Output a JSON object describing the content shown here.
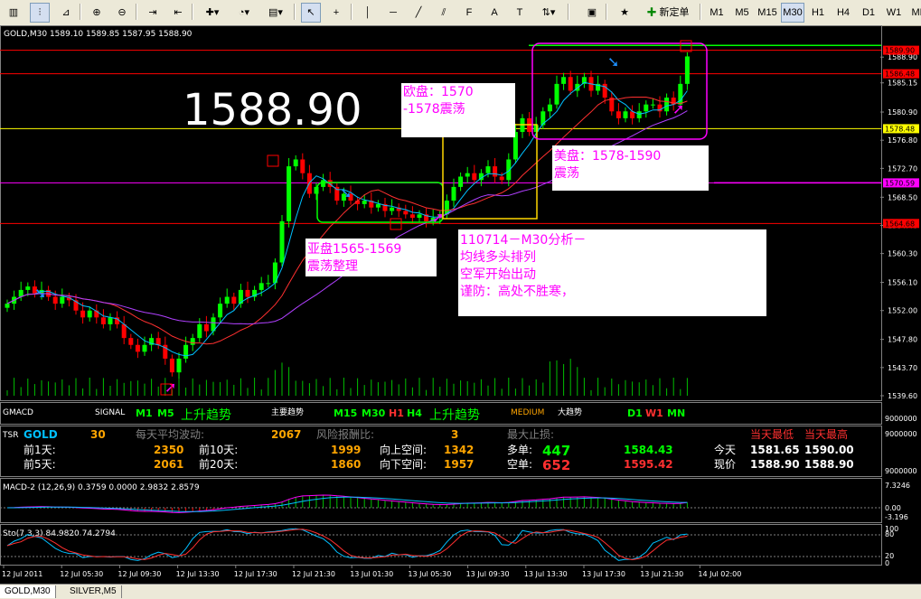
{
  "toolbar": {
    "new_order": "新定单",
    "periods": [
      "M1",
      "M5",
      "M15",
      "M30",
      "H1",
      "H4",
      "D1",
      "W1",
      "MN"
    ],
    "active_period": "M30"
  },
  "chart": {
    "header": "GOLD,M30  1589.10 1589.85 1587.95 1588.90",
    "big_price": "1588.90",
    "annotations": {
      "europe": [
        "欧盘：1570",
        "-1578震荡"
      ],
      "us": [
        "美盘：1578-1590",
        "震荡"
      ],
      "asia": [
        "亚盘1565-1569",
        "震荡整理"
      ],
      "analysis": [
        "110714－M30分析－",
        "均线多头排列",
        "空军开始出动",
        "谨防：高处不胜寒，"
      ]
    },
    "colors": {
      "bull": "#00ff00",
      "bear": "#ff0000",
      "ma_fast": "#00c0ff",
      "ma_mid": "#ff3030",
      "ma_slow": "#b040ff",
      "box_asia": "#00ff00",
      "box_eu": "#ffd700",
      "box_us": "#ff00ff"
    }
  },
  "chart_data": {
    "type": "candlestick",
    "symbol": "GOLD",
    "timeframe": "M30",
    "y_ticks": [
      "1588.90",
      "1585.15",
      "1580.90",
      "1576.80",
      "1572.70",
      "1568.50",
      "1564.40",
      "1560.30",
      "1556.10",
      "1552.00",
      "1547.80",
      "1543.70",
      "1539.60"
    ],
    "ylim": [
      1539.6,
      1590.9
    ],
    "price_tags": [
      {
        "label": "1589.90",
        "value": 1589.9,
        "color": "#ff0000"
      },
      {
        "label": "1586.48",
        "value": 1586.48,
        "color": "#ff0000"
      },
      {
        "label": "1578.48",
        "value": 1578.48,
        "color": "#ffff00"
      },
      {
        "label": "1570.59",
        "value": 1570.59,
        "color": "#ff00ff"
      },
      {
        "label": "1564.68",
        "value": 1564.68,
        "color": "#ff0000"
      }
    ],
    "x_labels": [
      "12 Jul 2011",
      "12 Jul 05:30",
      "12 Jul 09:30",
      "12 Jul 13:30",
      "12 Jul 17:30",
      "12 Jul 21:30",
      "13 Jul 01:30",
      "13 Jul 05:30",
      "13 Jul 09:30",
      "13 Jul 13:30",
      "13 Jul 17:30",
      "13 Jul 21:30",
      "14 Jul 02:00"
    ],
    "closes": [
      1553,
      1554,
      1555,
      1555.5,
      1554.5,
      1555,
      1554,
      1553,
      1554,
      1553.5,
      1552,
      1551,
      1552,
      1551,
      1550,
      1551,
      1550,
      1548,
      1547,
      1546,
      1547,
      1548,
      1547,
      1545,
      1543,
      1545,
      1547,
      1548,
      1550,
      1549,
      1551,
      1553,
      1554,
      1553,
      1555,
      1554,
      1555,
      1556,
      1556,
      1559,
      1565,
      1573,
      1574,
      1572,
      1569,
      1570,
      1571,
      1570,
      1568,
      1569,
      1568,
      1567.5,
      1568,
      1567,
      1567.5,
      1566.5,
      1567,
      1566.5,
      1566,
      1565.5,
      1566,
      1565,
      1565.5,
      1566,
      1568,
      1570,
      1571.5,
      1572,
      1571,
      1572,
      1573,
      1571.5,
      1571,
      1574,
      1578,
      1580,
      1578,
      1579,
      1581,
      1582,
      1585,
      1586,
      1584,
      1585,
      1586,
      1584,
      1585,
      1583,
      1581,
      1580,
      1581,
      1580,
      1581,
      1582,
      1582,
      1581,
      1583,
      1582,
      1585,
      1589
    ]
  },
  "signal_panel": {
    "name": "GMACD",
    "signal_label": "SIGNAL",
    "m1": "M1",
    "m5": "M5",
    "trend1": "上升趋势",
    "major": "主要趋势",
    "m15": "M15",
    "m30": "M30",
    "h1": "H1",
    "h4": "H4",
    "trend2": "上升趋势",
    "medium": "MEDIUM",
    "big": "大趋势",
    "d1": "D1",
    "w1": "W1",
    "mn": "MN",
    "scale": "9000000"
  },
  "tsr_panel": {
    "name": "TSR",
    "symbol": "GOLD",
    "num": "30",
    "avg_label": "每天平均波动:",
    "avg_value": "2067",
    "risk_label": "风险报酬比:",
    "risk_value": "3",
    "stop_label": "最大止损:",
    "prev1_label": "前1天:",
    "prev1": "2350",
    "prev10_label": "前10天:",
    "prev10": "1999",
    "prev5_label": "前5天:",
    "prev5": "2061",
    "prev20_label": "前20天:",
    "prev20": "1860",
    "up_label": "向上空间:",
    "up": "1342",
    "down_label": "向下空间:",
    "down": "1957",
    "long_label": "多单:",
    "long_stop": "447",
    "long_price": "1584.43",
    "short_label": "空单:",
    "short_stop": "652",
    "short_price": "1595.42",
    "today_low_label": "当天最低",
    "today_high_label": "当天最高",
    "today_label": "今天",
    "today_low": "1581.65",
    "today_high": "1590.00",
    "now_label": "现价",
    "now_low": "1588.90",
    "now_high": "1588.90",
    "scale_top": "9000000",
    "scale_bottom": "9000000"
  },
  "macd_panel": {
    "header": "MACD-2 (12,26,9) 0.3759 0.0000 2.9832 2.8579",
    "ticks": [
      "7.3246",
      "0.00",
      "-3.196"
    ]
  },
  "stoch_panel": {
    "header": "Sto(7,3,3) 84.9820 74.2794",
    "ticks": [
      "100",
      "80",
      "20",
      "0"
    ]
  },
  "tabs": [
    "GOLD,M30",
    "SILVER,M5"
  ]
}
